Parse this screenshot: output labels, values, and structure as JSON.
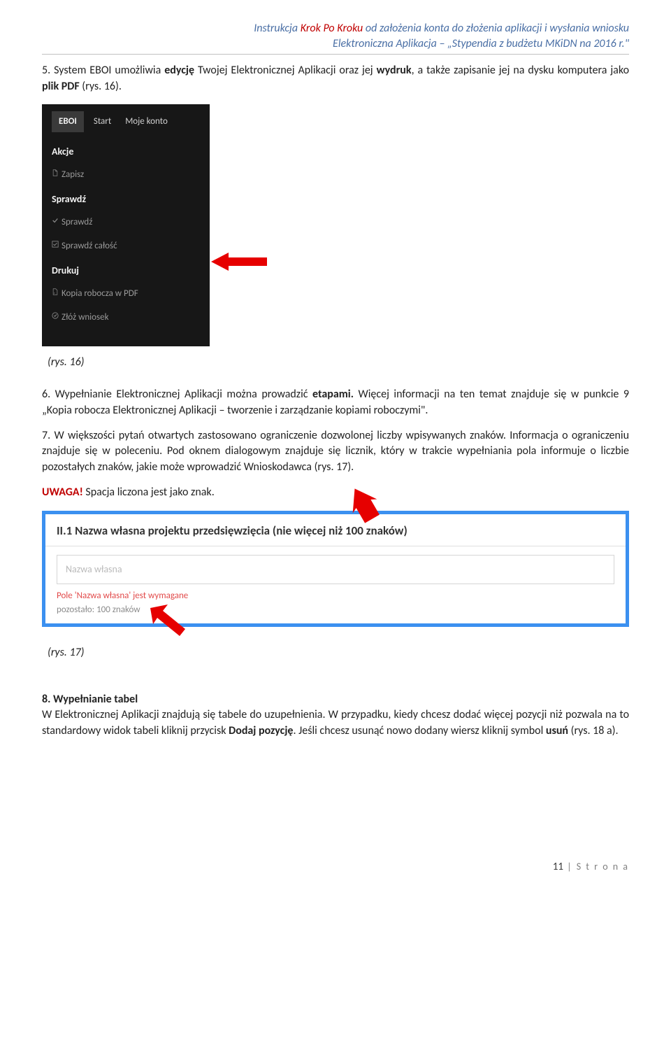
{
  "header": {
    "line1_prefix": "Instrukcja ",
    "line1_red": "Krok Po Kroku",
    "line1_suffix": "  od założenia konta do złożenia aplikacji i wysłania wniosku",
    "line2": "Elektroniczna Aplikacja – „Stypendia z budżetu MKiDN na 2016 r.\""
  },
  "p5_a": "5. System EBOI umożliwia ",
  "p5_b": "edycję",
  "p5_c": " Twojej Elektronicznej Aplikacji  oraz jej ",
  "p5_d": "wydruk",
  "p5_e": ", a także zapisanie jej na dysku komputera jako ",
  "p5_f": "plik PDF",
  "p5_g": " (rys. 16).",
  "eboi": {
    "logo": "EBOI",
    "top": {
      "start": "Start",
      "konto": "Moje konto"
    },
    "sec_akcje": "Akcje",
    "item_zapisz": "Zapisz",
    "sec_sprawdz": "Sprawdź",
    "item_sprawdz": "Sprawdź",
    "item_sprawdz_calosc": "Sprawdź całość",
    "sec_drukuj": "Drukuj",
    "item_pdf": "Kopia robocza w PDF",
    "item_zloz": "Złóż wniosek"
  },
  "cap16": "(rys. 16)",
  "p6_a": "6. Wypełnianie Elektronicznej Aplikacji  można prowadzić ",
  "p6_b": "etapami.",
  "p6_c": " Więcej informacji na ten temat znajduje się w punkcie 9 „Kopia robocza Elektronicznej Aplikacji – tworzenie i zarządzanie kopiami roboczymi\".",
  "p7": "7. W większości pytań otwartych zastosowano ograniczenie dozwolonej liczby wpisywanych znaków. Informacja o ograniczeniu znajduje się w poleceniu. Pod oknem dialogowym znajduje się licznik, który w trakcie wypełniania pola informuje o liczbie pozostałych znaków, jakie może wprowadzić Wnioskodawca (rys. 17).",
  "uwaga_a": "UWAGA!",
  "uwaga_b": " Spacja liczona jest jako znak.",
  "form": {
    "title": "II.1 Nazwa własna projektu przedsięwzięcia (nie więcej niż 100 znaków)",
    "placeholder": "Nazwa własna",
    "error": "Pole 'Nazwa własna' jest wymagane",
    "left": "pozostało: 100 znaków"
  },
  "cap17": "(rys. 17)",
  "p8_title": "8. Wypełnianie tabel",
  "p8_a": "W Elektronicznej Aplikacji  znajdują się tabele do uzupełnienia. W przypadku, kiedy chcesz dodać więcej pozycji niż pozwala na to standardowy widok tabeli kliknij przycisk ",
  "p8_b": "Dodaj pozycję",
  "p8_c": ". Jeśli chcesz usunąć nowo dodany wiersz kliknij symbol ",
  "p8_d": "usuń",
  "p8_e": " (rys. 18 a).",
  "footer": {
    "num": "11",
    "label": " | S t r o n a"
  }
}
